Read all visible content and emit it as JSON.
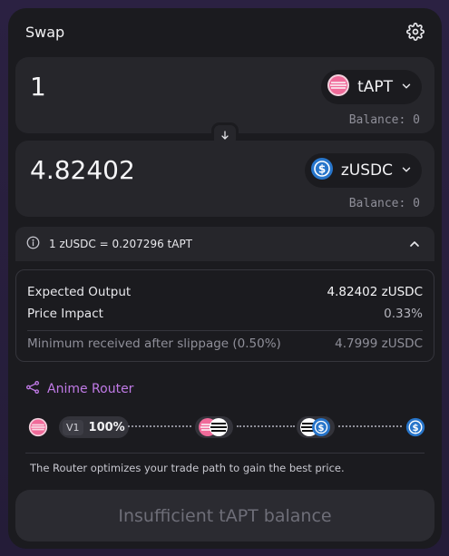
{
  "header": {
    "title": "Swap"
  },
  "from": {
    "amount": "1",
    "token": "tAPT",
    "balance": "Balance: 0"
  },
  "to": {
    "amount": "4.82402",
    "token": "zUSDC",
    "balance": "Balance: 0"
  },
  "rate": {
    "text": "1 zUSDC = 0.207296 tAPT"
  },
  "details": {
    "expected_label": "Expected Output",
    "expected_value": "4.82402 zUSDC",
    "impact_label": "Price Impact",
    "impact_value": "0.33%",
    "min_label": "Minimum received after slippage (0.50%)",
    "min_value": "4.7999 zUSDC"
  },
  "router": {
    "title": "Anime Router",
    "version": "V1",
    "percent": "100%",
    "note": "The Router optimizes your trade path to gain the best price."
  },
  "cta": {
    "label": "Insufficient tAPT balance"
  },
  "colors": {
    "accent": "#c07ae6",
    "usdc_blue": "#2775ca",
    "apt_pink": "#f06b9a"
  }
}
